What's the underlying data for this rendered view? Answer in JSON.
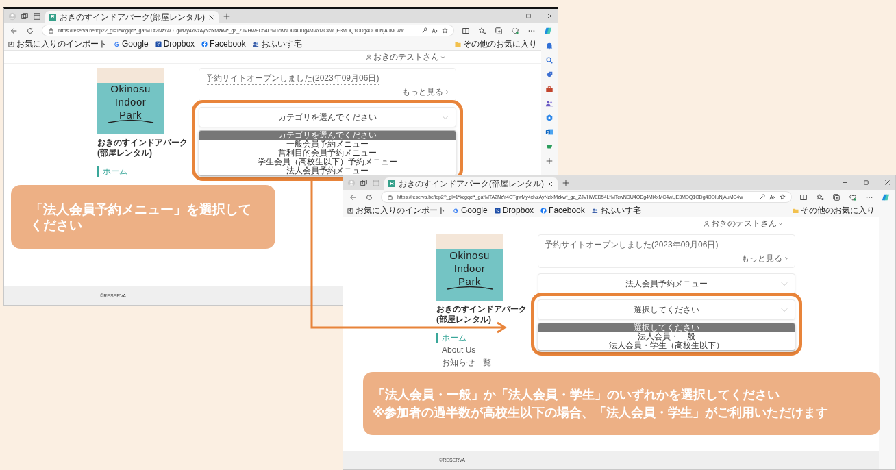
{
  "windows": [
    {
      "tab": {
        "favicon": "R",
        "title": "おきのすインドアパーク(部屋レンタル)"
      },
      "url": "https://reserva.be/idp2?_gl=1*kcgqcf*_ga*MTA2NzY4OTgwMy4xNzAyNzIxMzkw*_ga_ZJVHWED54L*MTcwNDU4ODg4Mi4xMC4wLjE3MDQ1ODg4ODIuNjAuMC4w",
      "bookmarks": [
        {
          "label": "お気に入りのインポート",
          "kind": "import"
        },
        {
          "label": "Google",
          "kind": "google"
        },
        {
          "label": "Dropbox",
          "kind": "dropbox"
        },
        {
          "label": "Facebook",
          "kind": "facebook"
        },
        {
          "label": "おふいす宅",
          "kind": "site"
        }
      ],
      "other_favorites": "その他のお気に入り",
      "user": "おきのテストさん",
      "logo": [
        "Okinosu",
        "Indoor",
        "Park"
      ],
      "site_name": "おきのすインドアパーク(部屋レンタル)",
      "nav": [
        {
          "label": "ホーム",
          "selected": true
        }
      ],
      "news": {
        "title": "予約サイトオープンしました(2023年09月06日)",
        "more": "もっと見る"
      },
      "selects": [
        {
          "value": "カテゴリを選んでください",
          "highlighted": true,
          "options": [
            {
              "label": "カテゴリを選んでください",
              "selected": true
            },
            {
              "label": "一般会員予約メニュー",
              "selected": false
            },
            {
              "label": "営利目的会員予約メニュー",
              "selected": false
            },
            {
              "label": "学生会員（高校生以下）予約メニュー",
              "selected": false
            },
            {
              "label": "法人会員予約メニュー",
              "selected": false
            }
          ]
        }
      ],
      "footer": "©RESERVA"
    },
    {
      "tab": {
        "favicon": "R",
        "title": "おきのすインドアパーク(部屋レンタル)"
      },
      "url": "https://reserva.be/idp2?_gl=1*kcgqcf*_ga*MTA2NzY4OTgwMy4xNzAyNzIxMzkw*_ga_ZJVHWED54L*MTcwNDU4ODg4Mi4xMC4wLjE3MDQ1ODg4ODIuNjAuMC4w",
      "bookmarks": [
        {
          "label": "お気に入りのインポート",
          "kind": "import"
        },
        {
          "label": "Google",
          "kind": "google"
        },
        {
          "label": "Dropbox",
          "kind": "dropbox"
        },
        {
          "label": "Facebook",
          "kind": "facebook"
        },
        {
          "label": "おふいす宅",
          "kind": "site"
        }
      ],
      "other_favorites": "その他のお気に入り",
      "user": "おきのテストさん",
      "logo": [
        "Okinosu",
        "Indoor",
        "Park"
      ],
      "site_name": "おきのすインドアパーク(部屋レンタル)",
      "nav": [
        {
          "label": "ホーム",
          "selected": true
        },
        {
          "label": "About Us",
          "selected": false
        },
        {
          "label": "お知らせ一覧",
          "selected": false
        }
      ],
      "news": {
        "title": "予約サイトオープンしました(2023年09月06日)",
        "more": "もっと見る"
      },
      "selects": [
        {
          "value": "法人会員予約メニュー",
          "highlighted": false
        },
        {
          "value": "選択してください",
          "highlighted": true,
          "options": [
            {
              "label": "選択してください",
              "selected": true
            },
            {
              "label": "法人会員・一般",
              "selected": false
            },
            {
              "label": "法人会員・学生（高校生以下）",
              "selected": false
            }
          ]
        }
      ],
      "footer": "©RESERVA"
    }
  ],
  "callouts": [
    {
      "lines": [
        "「法人会員予約メニュー」を選択してください"
      ]
    },
    {
      "lines": [
        "「法人会員・一般」か「法人会員・学生」のいずれかを選択してください",
        "※参加者の過半数が高校生以下の場合、「法人会員・学生」がご利用いただけます"
      ]
    }
  ]
}
